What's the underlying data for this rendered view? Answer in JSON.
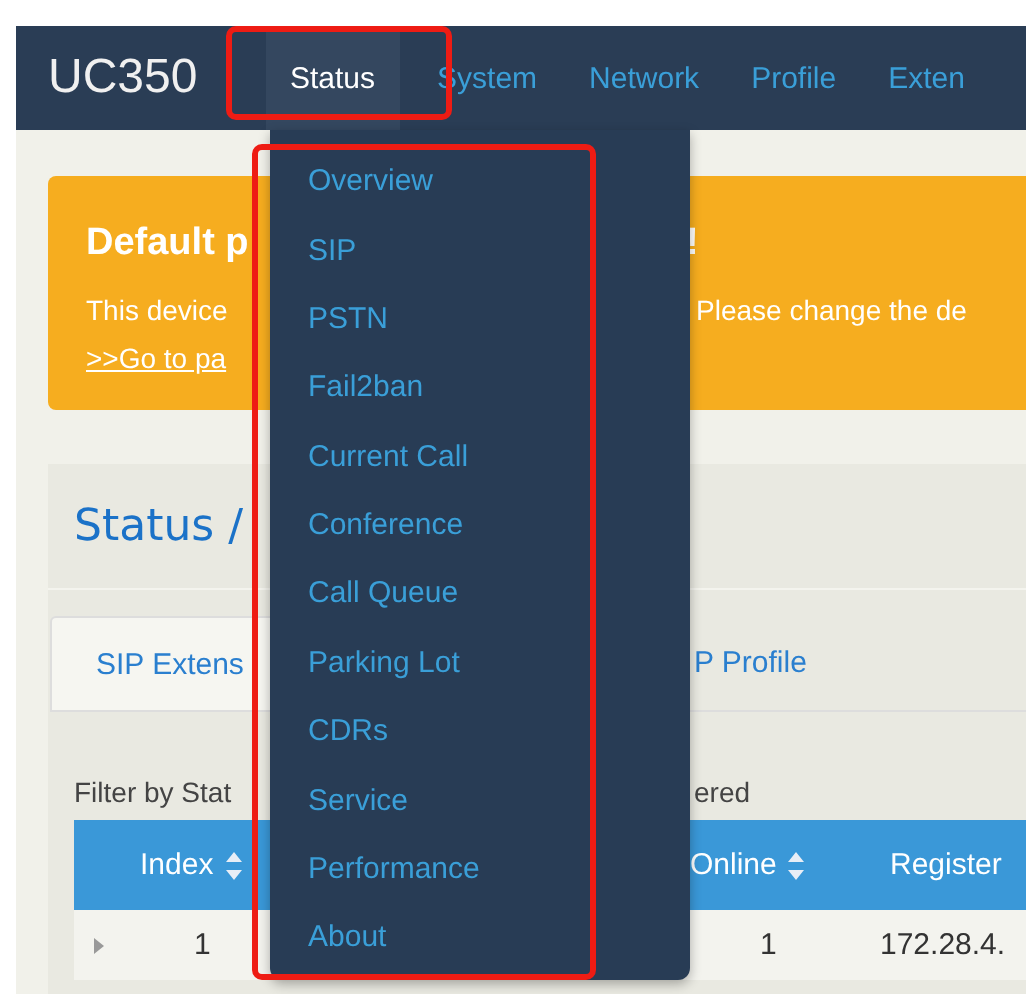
{
  "navbar": {
    "brand": "UC350",
    "selected_highlighted": true,
    "items": [
      {
        "label": "Status",
        "selected": true
      },
      {
        "label": "System",
        "selected": false
      },
      {
        "label": "Network",
        "selected": false
      },
      {
        "label": "Profile",
        "selected": false
      },
      {
        "label": "Exten",
        "selected": false
      }
    ]
  },
  "alert": {
    "title_start": "Default p",
    "title_end": "!",
    "text_start": "This device",
    "text_end": "Please change the de",
    "link": ">>Go to pa"
  },
  "panel": {
    "title": "Status /",
    "tabs": [
      {
        "label": "SIP Extens",
        "selected": true
      },
      {
        "label": "P Profile",
        "selected": false
      }
    ],
    "filter_start": "Filter by Stat",
    "filter_end": "ered",
    "table": {
      "columns": [
        {
          "label": "Index",
          "sortable": true
        },
        {
          "label": "Online",
          "sortable": true
        },
        {
          "label": "Register",
          "sortable": false
        }
      ],
      "rows": [
        {
          "expanded": false,
          "cells": [
            "1",
            "1",
            "172.28.4."
          ]
        }
      ]
    }
  },
  "dropdown": {
    "highlighted": true,
    "items": [
      {
        "label": "Overview"
      },
      {
        "label": "SIP"
      },
      {
        "label": "PSTN"
      },
      {
        "label": "Fail2ban"
      },
      {
        "label": "Current Call"
      },
      {
        "label": "Conference"
      },
      {
        "label": "Call Queue"
      },
      {
        "label": "Parking Lot"
      },
      {
        "label": "CDRs"
      },
      {
        "label": "Service"
      },
      {
        "label": "Performance"
      },
      {
        "label": "About"
      }
    ]
  }
}
